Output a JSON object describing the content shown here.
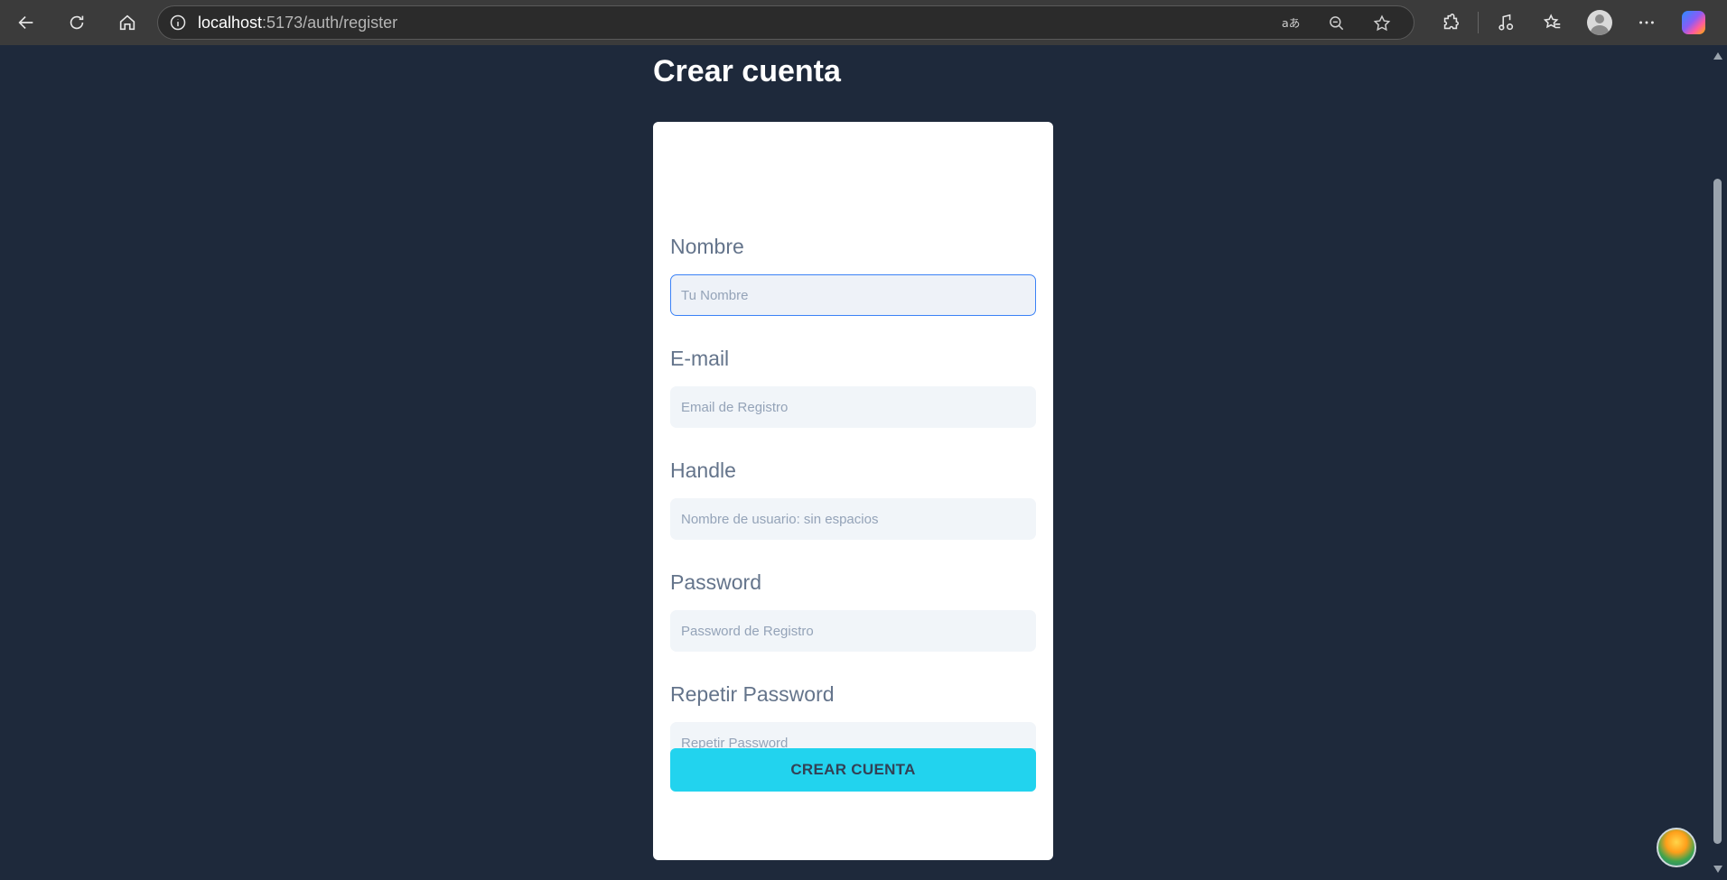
{
  "browser": {
    "url_host": "localhost",
    "url_path": ":5173/auth/register"
  },
  "page": {
    "title": "Crear cuenta"
  },
  "form": {
    "fields": [
      {
        "label": "Nombre",
        "placeholder": "Tu Nombre",
        "value": ""
      },
      {
        "label": "E-mail",
        "placeholder": "Email de Registro",
        "value": ""
      },
      {
        "label": "Handle",
        "placeholder": "Nombre de usuario: sin espacios",
        "value": ""
      },
      {
        "label": "Password",
        "placeholder": "Password de Registro",
        "value": ""
      },
      {
        "label": "Repetir Password",
        "placeholder": "Repetir Password",
        "value": ""
      }
    ],
    "submit_label": "CREAR CUENTA"
  },
  "colors": {
    "page_bg": "#1e293b",
    "card_bg": "#ffffff",
    "button_bg": "#22d3ee",
    "focus_border": "#3b82f6"
  },
  "icons": [
    "back-icon",
    "refresh-icon",
    "home-icon",
    "info-icon",
    "read-aloud-icon",
    "zoom-out-icon",
    "favorite-star-icon",
    "extensions-icon",
    "media-icon",
    "favorites-icon",
    "profile-avatar-icon",
    "more-options-icon",
    "copilot-icon"
  ]
}
